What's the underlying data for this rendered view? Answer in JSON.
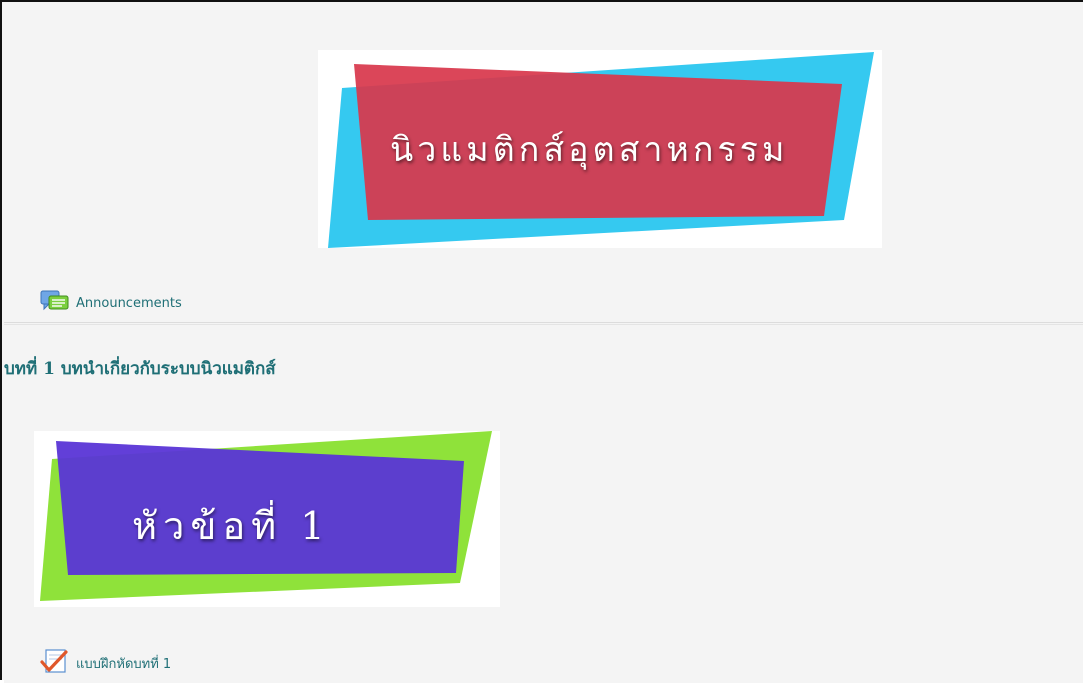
{
  "sections": [
    {
      "banner_text": "นิวแมติกส์อุตสาหกรรม",
      "banner_colors": {
        "back": "#35c9f0",
        "front": "#d8384c"
      },
      "activities": [
        {
          "label": "Announcements",
          "icon": "forum-icon"
        }
      ]
    },
    {
      "title": "บทที่ 1 บทนำเกี่ยวกับระบบนิวแมติกส์",
      "banner_text": "หัวข้อที่ 1",
      "banner_colors": {
        "back": "#8fe23a",
        "front": "#5a35d6"
      },
      "activities": [
        {
          "label": "แบบฝึกหัดบทที่ 1",
          "icon": "quiz-checkmark-icon"
        }
      ]
    }
  ],
  "colors": {
    "link": "#1f6f76",
    "section_bg": "#f4f4f4"
  }
}
